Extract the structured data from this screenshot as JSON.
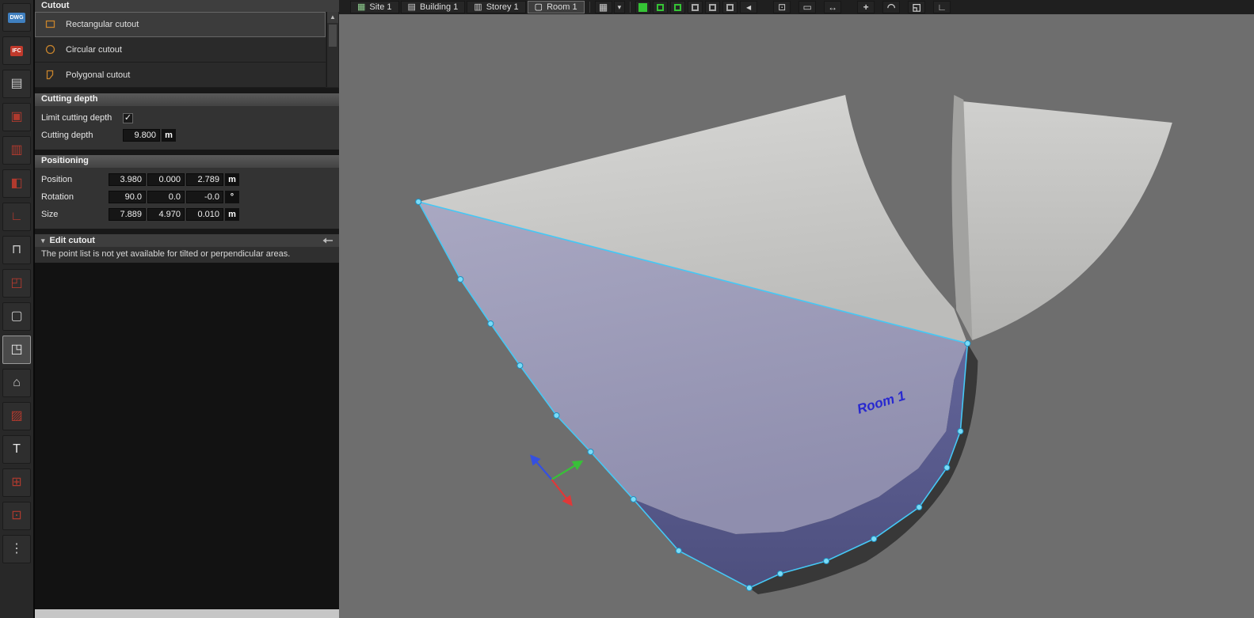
{
  "left_toolbar": {
    "tools": [
      {
        "name": "import-dwg-icon",
        "glyph": "DWG",
        "style": "badge",
        "color": "#3f7fbf"
      },
      {
        "name": "import-ifc-icon",
        "glyph": "IFC",
        "style": "badge",
        "color": "#c0392b"
      },
      {
        "name": "component-tool-icon",
        "glyph": "▤",
        "color": "#c9c9c9"
      },
      {
        "name": "wall-tool-icon",
        "glyph": "▣",
        "color": "#b03a2e"
      },
      {
        "name": "panel-tool-icon",
        "glyph": "▥",
        "color": "#b03a2e"
      },
      {
        "name": "door-tool-icon",
        "glyph": "◧",
        "color": "#b03a2e"
      },
      {
        "name": "corner-wall-tool-icon",
        "glyph": "∟",
        "color": "#b03a2e"
      },
      {
        "name": "window-tool-icon",
        "glyph": "⊓",
        "color": "#c9c9c9"
      },
      {
        "name": "opening-tool-icon",
        "glyph": "◰",
        "color": "#b03a2e"
      },
      {
        "name": "box-tool-icon",
        "glyph": "▢",
        "color": "#c9c9c9"
      },
      {
        "name": "cutout-tool-icon",
        "glyph": "◳",
        "color": "#e8e8e8",
        "selected": true
      },
      {
        "name": "roof-tool-icon",
        "glyph": "⌂",
        "color": "#c9c9c9"
      },
      {
        "name": "insulation-tool-icon",
        "glyph": "▨",
        "color": "#b03a2e"
      },
      {
        "name": "text-tool-icon",
        "glyph": "T",
        "color": "#e8e8e8"
      },
      {
        "name": "slab-plus-tool-icon",
        "glyph": "⊞",
        "color": "#b03a2e"
      },
      {
        "name": "marker-tool-icon",
        "glyph": "⊡",
        "color": "#b03a2e"
      },
      {
        "name": "levels-tool-icon",
        "glyph": "⋮",
        "color": "#c9c9c9"
      }
    ]
  },
  "panel": {
    "title": "Cutout",
    "cutout_types": [
      {
        "label": "Rectangular cutout",
        "selected": true
      },
      {
        "label": "Circular cutout",
        "selected": false
      },
      {
        "label": "Polygonal cutout",
        "selected": false
      }
    ],
    "scroll_up_glyph": "▲",
    "cutting_depth": {
      "header": "Cutting depth",
      "limit_label": "Limit cutting depth",
      "limit_checked": true,
      "check_glyph": "✓",
      "depth_label": "Cutting depth",
      "depth_value": "9.800",
      "depth_unit": "m"
    },
    "positioning": {
      "header": "Positioning",
      "rows": [
        {
          "label": "Position",
          "values": [
            "3.980",
            "0.000",
            "2.789"
          ],
          "unit": "m"
        },
        {
          "label": "Rotation",
          "values": [
            "90.0",
            "0.0",
            "-0.0"
          ],
          "unit": "°"
        },
        {
          "label": "Size",
          "values": [
            "7.889",
            "4.970",
            "0.010"
          ],
          "unit": "m"
        }
      ]
    },
    "edit_cutout": {
      "header": "Edit cutout",
      "chevron_glyph": "▾",
      "note": "The point list is not yet available for tilted or perpendicular areas."
    }
  },
  "top_toolbar": {
    "nav": [
      {
        "label": "Site 1",
        "icon": "site-icon",
        "glyph": "▦",
        "color": "#8fcf8f",
        "active": false
      },
      {
        "label": "Building 1",
        "icon": "building-icon",
        "glyph": "▤",
        "color": "#cfcfcf",
        "active": false
      },
      {
        "label": "Storey 1",
        "icon": "storey-icon",
        "glyph": "▥",
        "color": "#cfcfcf",
        "active": false
      },
      {
        "label": "Room 1",
        "icon": "room-icon",
        "glyph": "▢",
        "color": "#ffffff",
        "active": true
      }
    ],
    "grid": {
      "name": "grid-settings-icon",
      "glyph": "▦",
      "dropdown_name": "grid-dropdown-icon",
      "dropdown_glyph": "▾"
    },
    "view_modes": [
      {
        "name": "view-mode-solid-green-icon",
        "color": "#35c435",
        "filled": true
      },
      {
        "name": "view-mode-green-frame-1-icon",
        "color": "#35c435",
        "filled": false
      },
      {
        "name": "view-mode-green-frame-2-icon",
        "color": "#35c435",
        "filled": false
      },
      {
        "name": "view-mode-gray-frame-1-icon",
        "color": "#a8a8a8",
        "filled": false
      },
      {
        "name": "view-mode-gray-frame-2-icon",
        "color": "#a8a8a8",
        "filled": false
      },
      {
        "name": "view-mode-gray-frame-3-icon",
        "color": "#a8a8a8",
        "filled": false
      }
    ],
    "back_button": {
      "name": "collapse-left-icon",
      "glyph": "◀"
    },
    "right_tools": [
      {
        "name": "crop-region-icon",
        "glyph": "⊡"
      },
      {
        "name": "ruler-icon",
        "glyph": "▭"
      },
      {
        "name": "dimension-icon",
        "glyph": "↔"
      }
    ],
    "transform_tools": [
      {
        "name": "move-tool-icon",
        "glyph": "+"
      },
      {
        "name": "arc-tool-icon",
        "glyph": "◠"
      },
      {
        "name": "volume-tool-icon",
        "glyph": "◱"
      },
      {
        "name": "angle-tool-icon",
        "glyph": "∟"
      }
    ]
  },
  "viewport": {
    "room_label": "Room 1",
    "selection_color": "#45c8f5",
    "axis_colors": {
      "x": "#e03838",
      "y": "#38c038",
      "z": "#3550e0"
    }
  }
}
